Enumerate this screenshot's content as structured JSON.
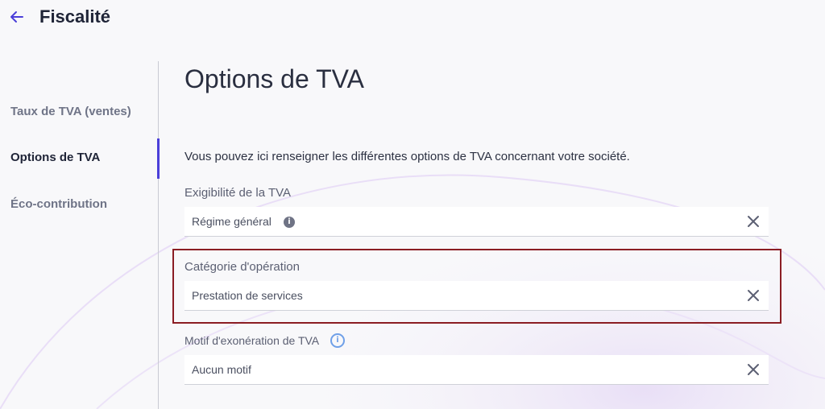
{
  "header": {
    "title": "Fiscalité",
    "back_icon": "arrow-left-icon",
    "accent": "#4b3fd9"
  },
  "sidebar": {
    "items": [
      {
        "label": "Taux de TVA (ventes)",
        "active": false
      },
      {
        "label": "Options de TVA",
        "active": true
      },
      {
        "label": "Éco-contribution",
        "active": false
      }
    ]
  },
  "main": {
    "title": "Options de TVA",
    "description": "Vous pouvez ici renseigner les différentes options de TVA concernant votre société.",
    "fields": {
      "exigibilite": {
        "label": "Exigibilité de la TVA",
        "value": "Régime général",
        "icon": "info-icon"
      },
      "categorie": {
        "label": "Catégorie d'opération",
        "value": "Prestation de services"
      },
      "motif": {
        "label": "Motif d'exonération de TVA",
        "value": "Aucun motif",
        "icon": "info-outline-icon"
      }
    },
    "clear_icon": "close-icon"
  },
  "highlight": {
    "color": "#8b1d23"
  }
}
